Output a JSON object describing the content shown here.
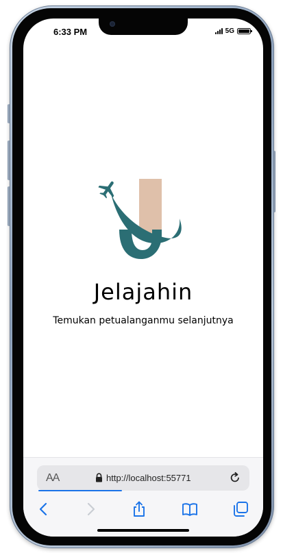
{
  "status_bar": {
    "time": "6:33 PM",
    "network": "5G"
  },
  "splash": {
    "app_name": "Jelajahin",
    "tagline": "Temukan petualanganmu selanjutnya",
    "logo_icon": "jelajahin-logo-plane-j",
    "colors": {
      "teal": "#2b6e74",
      "beige": "#dfc0aa"
    }
  },
  "browser": {
    "text_size_label": "AA",
    "url": "http://localhost:55771",
    "page_load_progress": 0.4,
    "accent": "#1a73e8",
    "toolbar": {
      "back_icon": "chevron-left-icon",
      "forward_icon": "chevron-right-icon",
      "share_icon": "share-icon",
      "bookmarks_icon": "book-icon",
      "tabs_icon": "tabs-icon"
    }
  }
}
